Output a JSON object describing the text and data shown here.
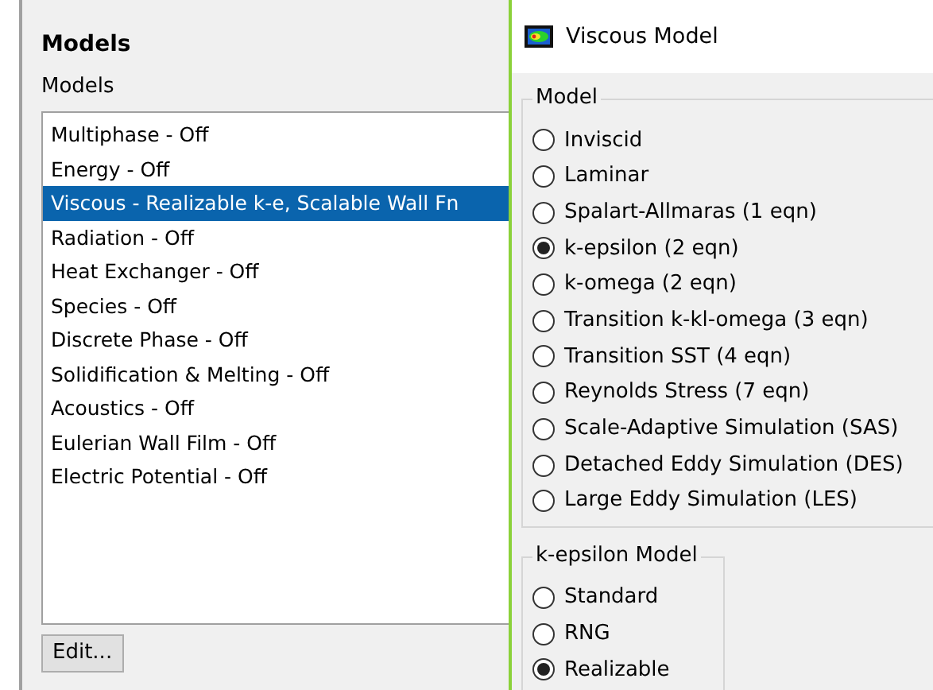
{
  "models_panel": {
    "title": "Models",
    "label": "Models",
    "items": [
      {
        "text": "Multiphase - Off",
        "selected": false
      },
      {
        "text": "Energy - Off",
        "selected": false
      },
      {
        "text": "Viscous - Realizable k-e, Scalable Wall Fn",
        "selected": true
      },
      {
        "text": "Radiation - Off",
        "selected": false
      },
      {
        "text": "Heat Exchanger - Off",
        "selected": false
      },
      {
        "text": "Species - Off",
        "selected": false
      },
      {
        "text": "Discrete Phase - Off",
        "selected": false
      },
      {
        "text": "Solidification & Melting - Off",
        "selected": false
      },
      {
        "text": "Acoustics - Off",
        "selected": false
      },
      {
        "text": "Eulerian Wall Film - Off",
        "selected": false
      },
      {
        "text": "Electric Potential - Off",
        "selected": false
      }
    ],
    "edit_button": "Edit..."
  },
  "dialog": {
    "title": "Viscous Model",
    "model_group": {
      "title": "Model",
      "options": [
        {
          "label": "Inviscid",
          "selected": false
        },
        {
          "label": "Laminar",
          "selected": false
        },
        {
          "label": "Spalart-Allmaras (1 eqn)",
          "selected": false
        },
        {
          "label": "k-epsilon (2 eqn)",
          "selected": true
        },
        {
          "label": "k-omega (2 eqn)",
          "selected": false
        },
        {
          "label": "Transition k-kl-omega (3 eqn)",
          "selected": false
        },
        {
          "label": "Transition SST (4 eqn)",
          "selected": false
        },
        {
          "label": "Reynolds Stress (7 eqn)",
          "selected": false
        },
        {
          "label": "Scale-Adaptive Simulation (SAS)",
          "selected": false
        },
        {
          "label": "Detached Eddy Simulation (DES)",
          "selected": false
        },
        {
          "label": "Large Eddy Simulation (LES)",
          "selected": false
        }
      ]
    },
    "kepsilon_group": {
      "title": "k-epsilon Model",
      "options": [
        {
          "label": "Standard",
          "selected": false
        },
        {
          "label": "RNG",
          "selected": false
        },
        {
          "label": "Realizable",
          "selected": true
        }
      ]
    }
  }
}
